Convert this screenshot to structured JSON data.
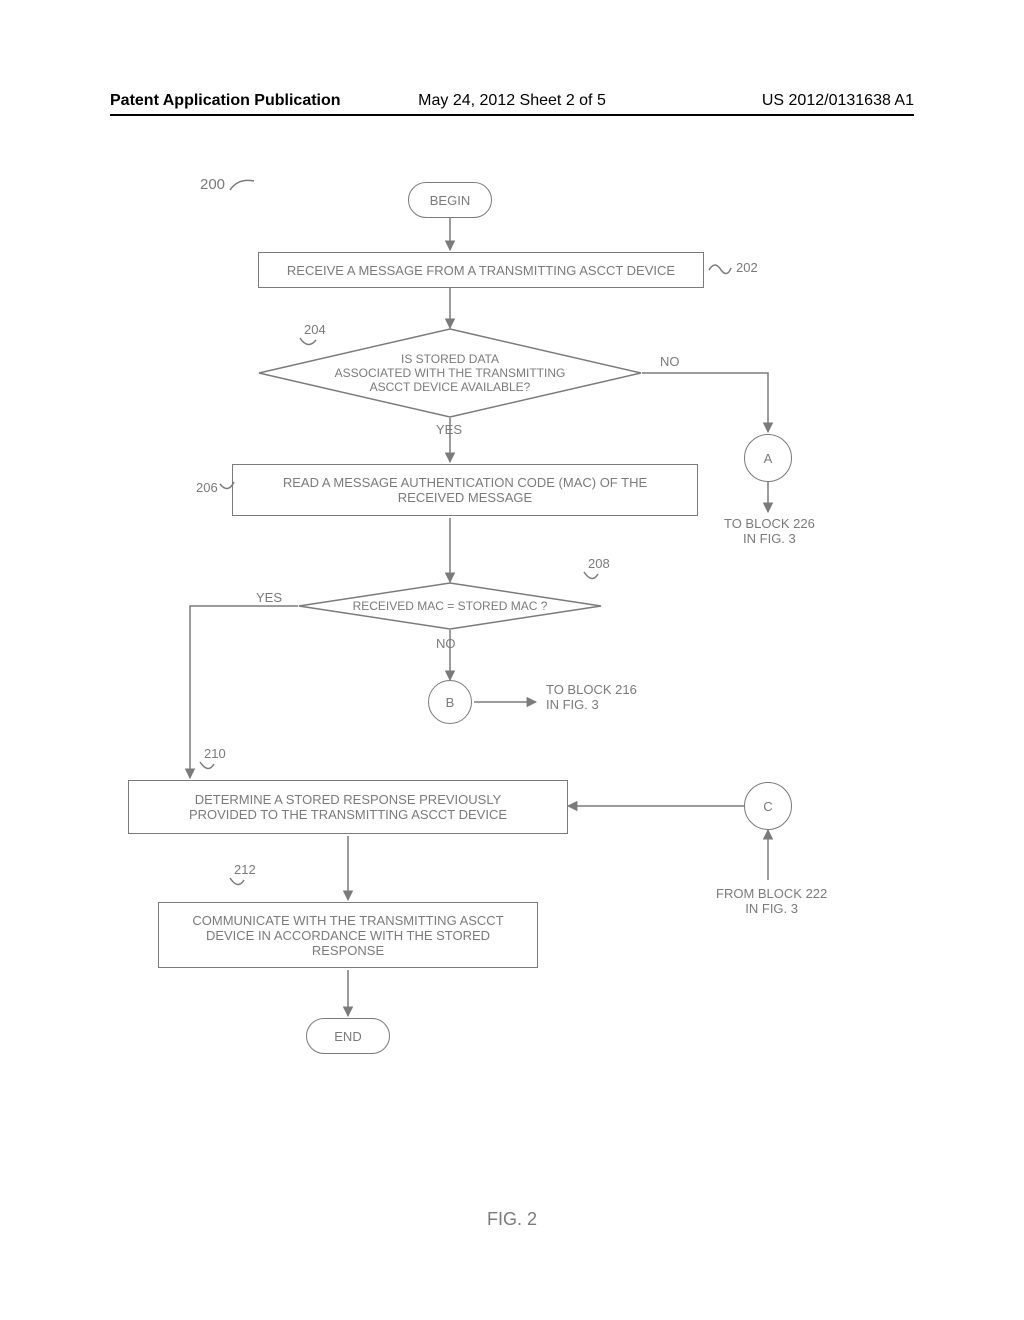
{
  "header": {
    "left": "Patent Application Publication",
    "middle": "May 24, 2012  Sheet 2 of 5",
    "right": "US 2012/0131638 A1"
  },
  "caption": "FIG. 2",
  "fig_ref": "200",
  "terminators": {
    "begin": "BEGIN",
    "end": "END"
  },
  "connectors": {
    "a": "A",
    "a_to": "TO BLOCK 226\nIN FIG. 3",
    "b": "B",
    "b_to": "TO BLOCK 216\nIN FIG. 3",
    "c": "C",
    "c_from": "FROM BLOCK 222\nIN FIG. 3"
  },
  "blocks": {
    "b202": {
      "ref": "202",
      "text": "RECEIVE A MESSAGE FROM A TRANSMITTING ASCCT DEVICE"
    },
    "d204": {
      "ref": "204",
      "text": "IS STORED DATA\nASSOCIATED WITH THE TRANSMITTING\nASCCT DEVICE AVAILABLE?",
      "yes": "YES",
      "no": "NO"
    },
    "b206": {
      "ref": "206",
      "text": "READ A MESSAGE AUTHENTICATION CODE (MAC) OF THE\nRECEIVED MESSAGE"
    },
    "d208": {
      "ref": "208",
      "text": "RECEIVED MAC = STORED MAC ?",
      "yes": "YES",
      "no": "NO"
    },
    "b210": {
      "ref": "210",
      "text": "DETERMINE A STORED RESPONSE PREVIOUSLY\nPROVIDED TO THE TRANSMITTING ASCCT DEVICE"
    },
    "b212": {
      "ref": "212",
      "text": "COMMUNICATE WITH THE TRANSMITTING ASCCT\nDEVICE IN ACCORDANCE WITH THE STORED\nRESPONSE"
    }
  }
}
